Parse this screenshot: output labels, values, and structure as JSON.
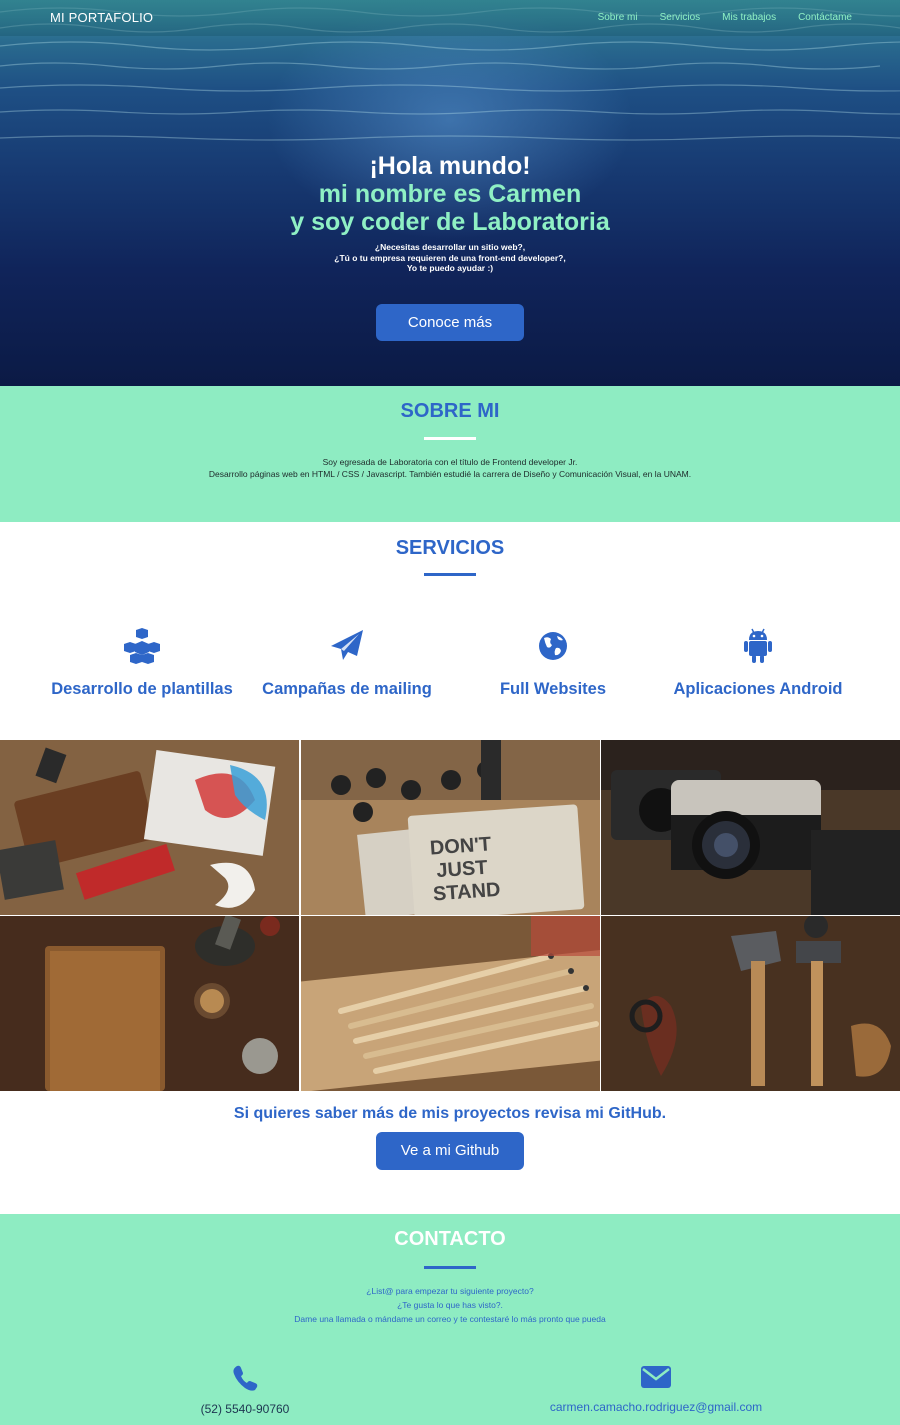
{
  "nav": {
    "brand": "MI PORTAFOLIO",
    "links": [
      "Sobre mi",
      "Servicios",
      "Mis trabajos",
      "Contáctame"
    ]
  },
  "hero": {
    "line1": "¡Hola mundo!",
    "line2": "mi nombre es Carmen",
    "line3": "y soy coder de Laboratoria",
    "sub": [
      "¿Necesitas desarrollar un sitio web?,",
      "¿Tú o tu empresa requieren de una front-end developer?,",
      "Yo te puedo ayudar :)"
    ],
    "button": "Conoce más"
  },
  "about": {
    "title": "SOBRE MI",
    "lines": [
      "Soy egresada de Laboratoria con el título de Frontend developer Jr.",
      "Desarrollo páginas web en HTML / CSS / Javascript. También estudié la carrera de Diseño y Comunicación Visual, en la UNAM."
    ]
  },
  "services": {
    "title": "SERVICIOS",
    "items": [
      {
        "label": "Desarrollo de plantillas",
        "icon": "cubes-icon"
      },
      {
        "label": "Campañas de mailing",
        "icon": "paper-plane-icon"
      },
      {
        "label": "Full Websites",
        "icon": "globe-icon"
      },
      {
        "label": "Aplicaciones Android",
        "icon": "android-icon"
      }
    ]
  },
  "gallery": {
    "items": [
      "workshop-letterpress",
      "dont-just-stand-there-cards",
      "vintage-cameras",
      "leather-notebook-spices",
      "pencils-and-rulers",
      "axe-and-hammer-tools"
    ]
  },
  "cta": {
    "text": "Si quieres saber más de mis proyectos revisa mi GitHub.",
    "button": "Ve a mi Github"
  },
  "contact": {
    "title": "CONTACTO",
    "lines": [
      "¿List@ para empezar tu siguiente proyecto?",
      "¿Te gusta lo que has visto?.",
      "Dame una llamada o mándame un correo y te contestaré lo más pronto que pueda"
    ],
    "phone": "(52) 5540-90760",
    "email": "carmen.camacho.rodriguez@gmail.com"
  },
  "colors": {
    "accent": "#2e66c8",
    "mint": "#8eecc2",
    "nav_link": "#8ff0c4",
    "hero_dark": "#0b1a45"
  }
}
